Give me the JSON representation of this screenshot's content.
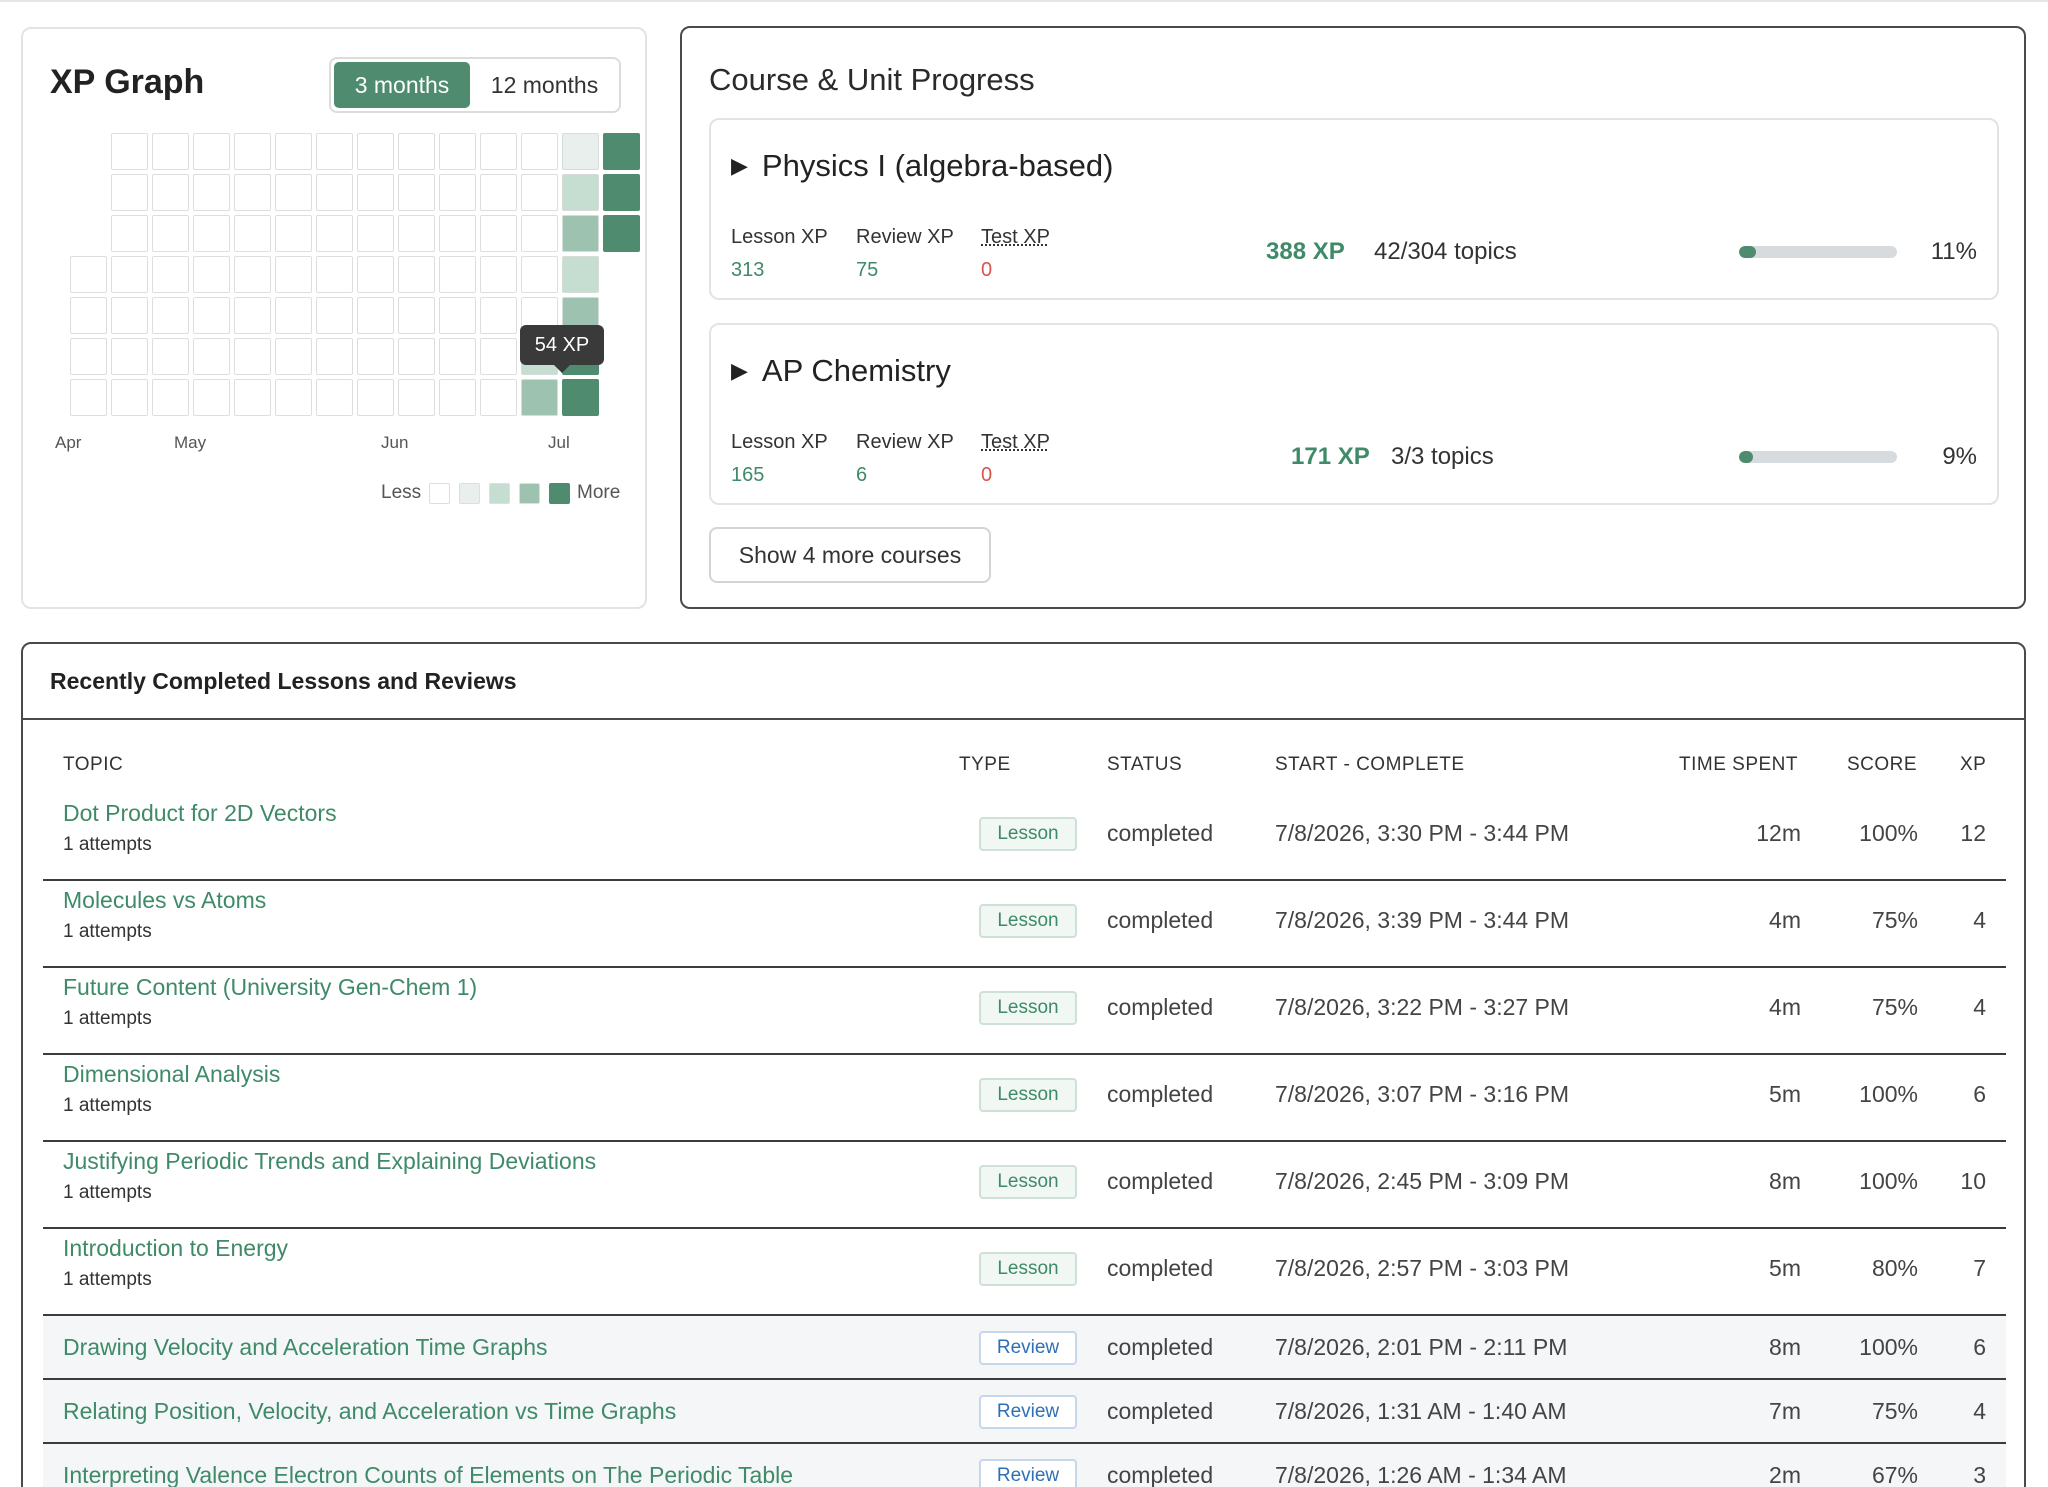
{
  "xp_graph": {
    "title": "XP Graph",
    "range_options": [
      "3 months",
      "12 months"
    ],
    "selected_range": "3 months",
    "months": [
      "Apr",
      "May",
      "Jun",
      "Jul"
    ],
    "tooltip": "54 XP",
    "legend_less": "Less",
    "legend_more": "More",
    "colors": {
      "empty": "#ffffff",
      "l1": "#e9efec",
      "l2": "#c6ddd2",
      "l3": "#9dc3b0",
      "l4": "#4f8b6e"
    }
  },
  "courses": {
    "title": "Course & Unit Progress",
    "items": [
      {
        "name": "Physics I (algebra-based)",
        "lesson_label": "Lesson XP",
        "lesson_xp": "313",
        "review_label": "Review XP",
        "review_xp": "75",
        "test_label": "Test XP",
        "test_xp": "0",
        "total_xp": "388 XP",
        "topics": "42/304 topics",
        "progress": 11,
        "percent": "11%"
      },
      {
        "name": "AP Chemistry",
        "lesson_label": "Lesson XP",
        "lesson_xp": "165",
        "review_label": "Review XP",
        "review_xp": "6",
        "test_label": "Test XP",
        "test_xp": "0",
        "total_xp": "171 XP",
        "topics": "3/3 topics",
        "progress": 9,
        "percent": "9%"
      }
    ],
    "more_button": "Show 4 more courses"
  },
  "recent": {
    "title": "Recently Completed Lessons and Reviews",
    "columns": {
      "topic": "TOPIC",
      "type": "TYPE",
      "status": "STATUS",
      "start_complete": "START - COMPLETE",
      "time_spent": "TIME SPENT",
      "score": "SCORE",
      "xp": "XP"
    },
    "rows": [
      {
        "topic": "Dot Product for 2D Vectors",
        "attempts": "1 attempts",
        "type": "Lesson",
        "status": "completed",
        "time": "7/8/2026, 3:30 PM - 3:44 PM",
        "spent": "12m",
        "score": "100%",
        "xp": "12"
      },
      {
        "topic": "Molecules vs Atoms",
        "attempts": "1 attempts",
        "type": "Lesson",
        "status": "completed",
        "time": "7/8/2026, 3:39 PM - 3:44 PM",
        "spent": "4m",
        "score": "75%",
        "xp": "4"
      },
      {
        "topic": "Future Content (University Gen-Chem 1)",
        "attempts": "1 attempts",
        "type": "Lesson",
        "status": "completed",
        "time": "7/8/2026, 3:22 PM - 3:27 PM",
        "spent": "4m",
        "score": "75%",
        "xp": "4"
      },
      {
        "topic": "Dimensional Analysis",
        "attempts": "1 attempts",
        "type": "Lesson",
        "status": "completed",
        "time": "7/8/2026, 3:07 PM - 3:16 PM",
        "spent": "5m",
        "score": "100%",
        "xp": "6"
      },
      {
        "topic": "Justifying Periodic Trends and Explaining Deviations",
        "attempts": "1 attempts",
        "type": "Lesson",
        "status": "completed",
        "time": "7/8/2026, 2:45 PM - 3:09 PM",
        "spent": "8m",
        "score": "100%",
        "xp": "10"
      },
      {
        "topic": "Introduction to Energy",
        "attempts": "1 attempts",
        "type": "Lesson",
        "status": "completed",
        "time": "7/8/2026, 2:57 PM - 3:03 PM",
        "spent": "5m",
        "score": "80%",
        "xp": "7"
      },
      {
        "topic": "Drawing Velocity and Acceleration Time Graphs",
        "attempts": "",
        "type": "Review",
        "status": "completed",
        "time": "7/8/2026, 2:01 PM - 2:11 PM",
        "spent": "8m",
        "score": "100%",
        "xp": "6"
      },
      {
        "topic": "Relating Position, Velocity, and Acceleration vs Time Graphs",
        "attempts": "",
        "type": "Review",
        "status": "completed",
        "time": "7/8/2026, 1:31 AM - 1:40 AM",
        "spent": "7m",
        "score": "75%",
        "xp": "4"
      },
      {
        "topic": "Interpreting Valence Electron Counts of Elements on The Periodic Table",
        "attempts": "",
        "type": "Review",
        "status": "completed",
        "time": "7/8/2026, 1:26 AM - 1:34 AM",
        "spent": "2m",
        "score": "67%",
        "xp": "3"
      }
    ]
  }
}
